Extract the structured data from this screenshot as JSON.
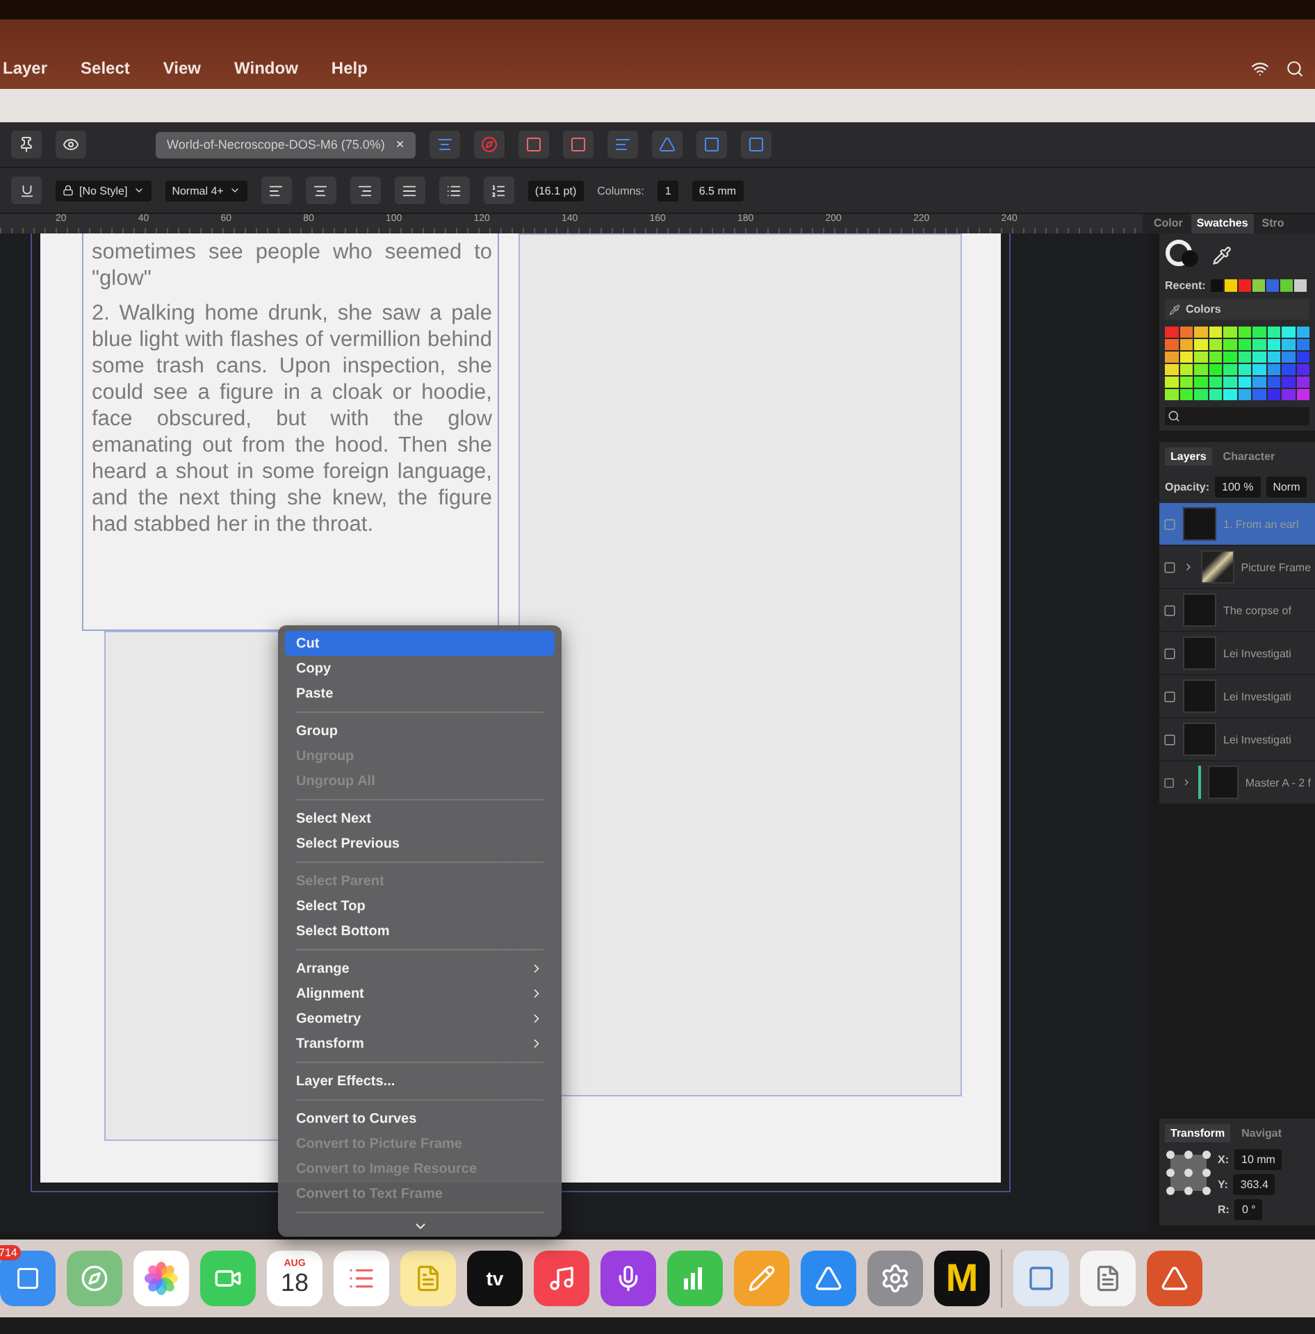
{
  "menu_bar": {
    "items": [
      "Layer",
      "Select",
      "View",
      "Window",
      "Help"
    ]
  },
  "document_tab": {
    "title": "World-of-Necroscope-DOS-M6 (75.0%)",
    "close": "×"
  },
  "context_toolbar": {
    "paragraph_style": "[No Style]",
    "text_style": "Normal 4+",
    "leading": "(16.1 pt)",
    "columns_label": "Columns:",
    "columns": "1",
    "gutter": "6.5 mm"
  },
  "ruler": {
    "marks": [
      "20",
      "40",
      "60",
      "80",
      "100",
      "120",
      "140",
      "160",
      "180",
      "200",
      "220",
      "240"
    ]
  },
  "page": {
    "paragraphs": [
      "sometimes see people who seemed to \"glow\"",
      "2. Walking home drunk, she saw a pale blue light with flashes of vermillion behind some trash cans. Upon inspection, she could see a figure in a cloak or hoodie, face obscured, but with the glow emanating out from the hood. Then she heard a shout in some foreign language, and the next thing she knew, the figure had stabbed her in the throat."
    ]
  },
  "context_menu": {
    "items": [
      {
        "kind": "item",
        "label": "Cut",
        "selected": true,
        "disabled": false,
        "submenu": false
      },
      {
        "kind": "item",
        "label": "Copy",
        "selected": false,
        "disabled": false,
        "submenu": false
      },
      {
        "kind": "item",
        "label": "Paste",
        "selected": false,
        "disabled": false,
        "submenu": false
      },
      {
        "kind": "separator"
      },
      {
        "kind": "item",
        "label": "Group",
        "selected": false,
        "disabled": false,
        "submenu": false
      },
      {
        "kind": "item",
        "label": "Ungroup",
        "selected": false,
        "disabled": true,
        "submenu": false
      },
      {
        "kind": "item",
        "label": "Ungroup All",
        "selected": false,
        "disabled": true,
        "submenu": false
      },
      {
        "kind": "separator"
      },
      {
        "kind": "item",
        "label": "Select Next",
        "selected": false,
        "disabled": false,
        "submenu": false
      },
      {
        "kind": "item",
        "label": "Select Previous",
        "selected": false,
        "disabled": false,
        "submenu": false
      },
      {
        "kind": "separator"
      },
      {
        "kind": "item",
        "label": "Select Parent",
        "selected": false,
        "disabled": true,
        "submenu": false
      },
      {
        "kind": "item",
        "label": "Select Top",
        "selected": false,
        "disabled": false,
        "submenu": false
      },
      {
        "kind": "item",
        "label": "Select Bottom",
        "selected": false,
        "disabled": false,
        "submenu": false
      },
      {
        "kind": "separator"
      },
      {
        "kind": "item",
        "label": "Arrange",
        "selected": false,
        "disabled": false,
        "submenu": true
      },
      {
        "kind": "item",
        "label": "Alignment",
        "selected": false,
        "disabled": false,
        "submenu": true
      },
      {
        "kind": "item",
        "label": "Geometry",
        "selected": false,
        "disabled": false,
        "submenu": true
      },
      {
        "kind": "item",
        "label": "Transform",
        "selected": false,
        "disabled": false,
        "submenu": true
      },
      {
        "kind": "separator"
      },
      {
        "kind": "item",
        "label": "Layer Effects...",
        "selected": false,
        "disabled": false,
        "submenu": false
      },
      {
        "kind": "separator"
      },
      {
        "kind": "item",
        "label": "Convert to Curves",
        "selected": false,
        "disabled": false,
        "submenu": false
      },
      {
        "kind": "item",
        "label": "Convert to Picture Frame",
        "selected": false,
        "disabled": true,
        "submenu": false
      },
      {
        "kind": "item",
        "label": "Convert to Image Resource",
        "selected": false,
        "disabled": true,
        "submenu": false
      },
      {
        "kind": "item",
        "label": "Convert to Text Frame",
        "selected": false,
        "disabled": true,
        "submenu": false
      },
      {
        "kind": "separator"
      }
    ]
  },
  "swatches_panel": {
    "tabs": [
      {
        "label": "Color",
        "selected": false
      },
      {
        "label": "Swatches",
        "selected": true
      },
      {
        "label": "Stro",
        "selected": false
      }
    ],
    "recent_label": "Recent:",
    "palette": "Colors"
  },
  "layers_panel": {
    "tabs": [
      {
        "label": "Layers",
        "selected": true
      },
      {
        "label": "Character",
        "selected": false
      }
    ],
    "opacity_label": "Opacity:",
    "opacity": "100 %",
    "blend_mode": "Norm",
    "layers": [
      {
        "kind": "text",
        "name": "1. From an earl",
        "selected": true
      },
      {
        "kind": "picture",
        "name": "Picture Frame",
        "selected": false
      },
      {
        "kind": "text",
        "name": "The corpse of",
        "selected": false
      },
      {
        "kind": "text",
        "name": "Lei Investigati",
        "selected": false
      },
      {
        "kind": "text",
        "name": "Lei Investigati",
        "selected": false
      },
      {
        "kind": "text",
        "name": "Lei Investigati",
        "selected": false
      },
      {
        "kind": "master",
        "name": "Master A - 2 f",
        "selected": false
      }
    ]
  },
  "transform_panel": {
    "tabs": [
      {
        "label": "Transform",
        "selected": true
      },
      {
        "label": "Navigat",
        "selected": false
      }
    ],
    "fields": [
      {
        "label": "X:",
        "value": "10 mm"
      },
      {
        "label": "Y:",
        "value": "363.4"
      },
      {
        "label": "R:",
        "value": "0 °"
      }
    ]
  },
  "dock": {
    "items": [
      {
        "kind": "mail",
        "badge": "714"
      },
      {
        "kind": "maps"
      },
      {
        "kind": "photos"
      },
      {
        "kind": "facetime"
      },
      {
        "kind": "calendar",
        "month": "AUG",
        "day": "18"
      },
      {
        "kind": "reminders"
      },
      {
        "kind": "notes"
      },
      {
        "kind": "tv",
        "label": "tv"
      },
      {
        "kind": "music"
      },
      {
        "kind": "podcasts"
      },
      {
        "kind": "numbers"
      },
      {
        "kind": "pages"
      },
      {
        "kind": "appstore"
      },
      {
        "kind": "settings"
      },
      {
        "kind": "mapp",
        "label": "M"
      },
      {
        "kind": "divider"
      },
      {
        "kind": "preview"
      },
      {
        "kind": "textedit"
      },
      {
        "kind": "publisher"
      }
    ]
  }
}
